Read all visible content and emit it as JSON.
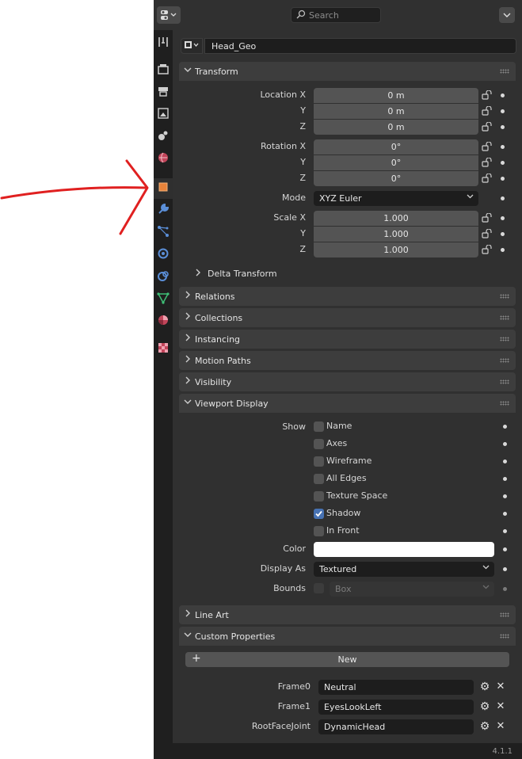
{
  "header": {
    "search_placeholder": "Search"
  },
  "object": {
    "name": "Head_Geo"
  },
  "transform": {
    "title": "Transform",
    "location_label": "Location X",
    "rotation_label": "Rotation X",
    "scale_label": "Scale X",
    "axis_y": "Y",
    "axis_z": "Z",
    "location": [
      "0 m",
      "0 m",
      "0 m"
    ],
    "rotation": [
      "0°",
      "0°",
      "0°"
    ],
    "mode_label": "Mode",
    "mode_value": "XYZ Euler",
    "scale": [
      "1.000",
      "1.000",
      "1.000"
    ],
    "delta": "Delta Transform"
  },
  "collapsed_panels": [
    "Relations",
    "Collections",
    "Instancing",
    "Motion Paths",
    "Visibility"
  ],
  "viewport_display": {
    "title": "Viewport Display",
    "show_label": "Show",
    "options": [
      {
        "label": "Name",
        "checked": false
      },
      {
        "label": "Axes",
        "checked": false
      },
      {
        "label": "Wireframe",
        "checked": false
      },
      {
        "label": "All Edges",
        "checked": false
      },
      {
        "label": "Texture Space",
        "checked": false
      },
      {
        "label": "Shadow",
        "checked": true
      },
      {
        "label": "In Front",
        "checked": false
      }
    ],
    "color_label": "Color",
    "color_value": "#ffffff",
    "display_as_label": "Display As",
    "display_as_value": "Textured",
    "bounds_label": "Bounds",
    "bounds_value": "Box"
  },
  "line_art": "Line Art",
  "custom_properties": {
    "title": "Custom Properties",
    "new_label": "New",
    "props": [
      {
        "name": "Frame0",
        "value": "Neutral"
      },
      {
        "name": "Frame1",
        "value": "EyesLookLeft"
      },
      {
        "name": "RootFaceJoint",
        "value": "DynamicHead"
      }
    ]
  },
  "status": {
    "version": "4.1.1"
  },
  "colors": {
    "annotation_arrow": "#e02020",
    "active_tab_accent": "#e8833a",
    "checkbox_checked": "#4772b3"
  }
}
